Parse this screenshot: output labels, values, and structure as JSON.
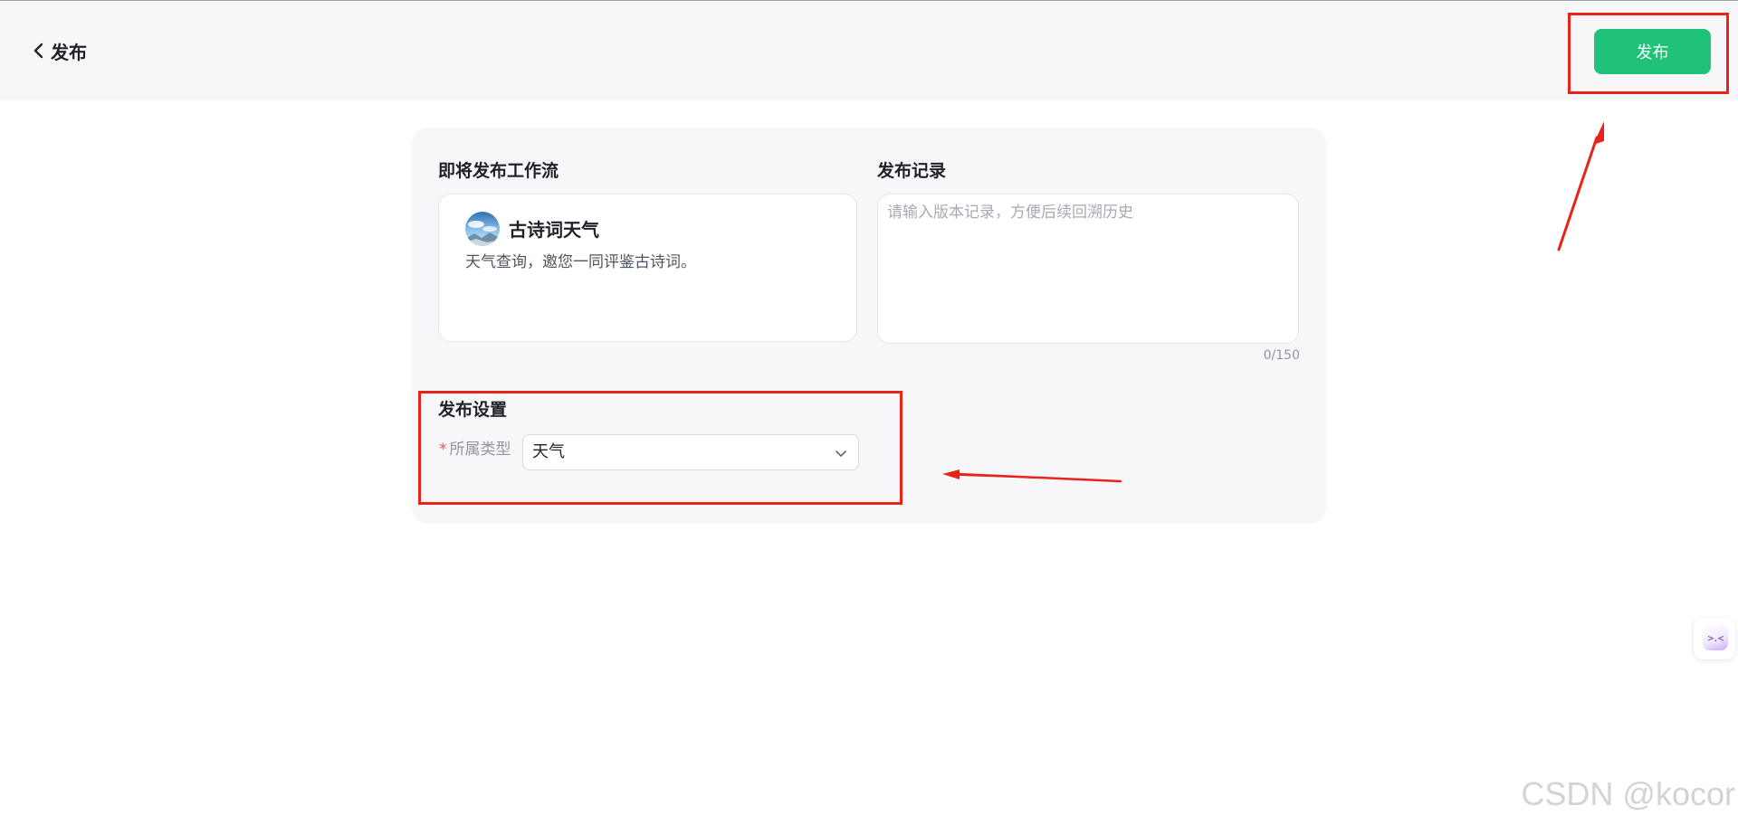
{
  "header": {
    "back_label": "发布",
    "publish_button": "发布"
  },
  "workflow": {
    "section_title": "即将发布工作流",
    "name": "古诗词天气",
    "description": "天气查询，邀您一同评鉴古诗词。"
  },
  "record": {
    "section_title": "发布记录",
    "placeholder": "请输入版本记录，方便后续回溯历史",
    "value": "",
    "counter": "0/150"
  },
  "settings": {
    "section_title": "发布设置",
    "required_mark": "*",
    "type_label": "所属类型",
    "type_value": "天气"
  },
  "floating_button": {
    "glyph": ">.<"
  },
  "watermark": "CSDN @kocor",
  "colors": {
    "accent_green": "#20c27a",
    "annotation_red": "#e8231a",
    "panel_bg": "#f7f7fa"
  }
}
